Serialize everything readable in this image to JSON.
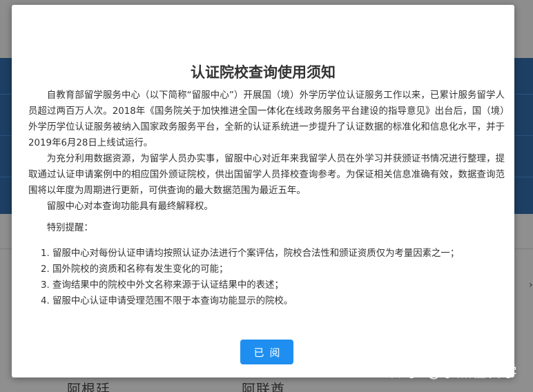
{
  "background": {
    "left_country": "阿根廷",
    "right_country": "阿联酋"
  },
  "modal": {
    "title": "认证院校查询使用须知",
    "paragraphs": [
      "自教育部留学服务中心（以下简称“留服中心”）开展国（境）外学历学位认证服务工作以来，已累计服务留学人员超过两百万人次。2018年《国务院关于加快推进全国一体化在线政务服务平台建设的指导意见》出台后，国（境）外学历学位认证服务被纳入国家政务服务平台，全新的认证系统进一步提升了认证数据的标准化和信息化水平，并于2019年6月28日上线试运行。",
      "为充分利用数据资源，为留学人员办实事，留服中心对近年来我留学人员在外学习并获颁证书情况进行整理，提取通过认证申请案例中的相应国外颁证院校，供出国留学人员择校查询参考。为保证相关信息准确有效，数据查询范围将以年度为周期进行更新，可供查询的最大数据范围为最近五年。",
      "留服中心对本查询功能具有最终解释权。"
    ],
    "notice_label": "特别提醒：",
    "notices": [
      "1. 留服中心对每份认证申请均按照认证办法进行个案评估，院校合法性和颁证资质仅为考量因素之一；",
      "2. 国外院校的资质和名称有发生变化的可能；",
      "3. 查询结果中的院校中外文名称来源于认证结果中的表述；",
      "4. 留服中心认证申请受理范围不限于本查询功能显示的院校。"
    ],
    "ack_button": "已阅"
  },
  "watermark": "知乎 @小熊在留学",
  "colors": {
    "button": "#1e8ff0",
    "band": "#1d3f63",
    "overlay": "#8c8c8c"
  }
}
